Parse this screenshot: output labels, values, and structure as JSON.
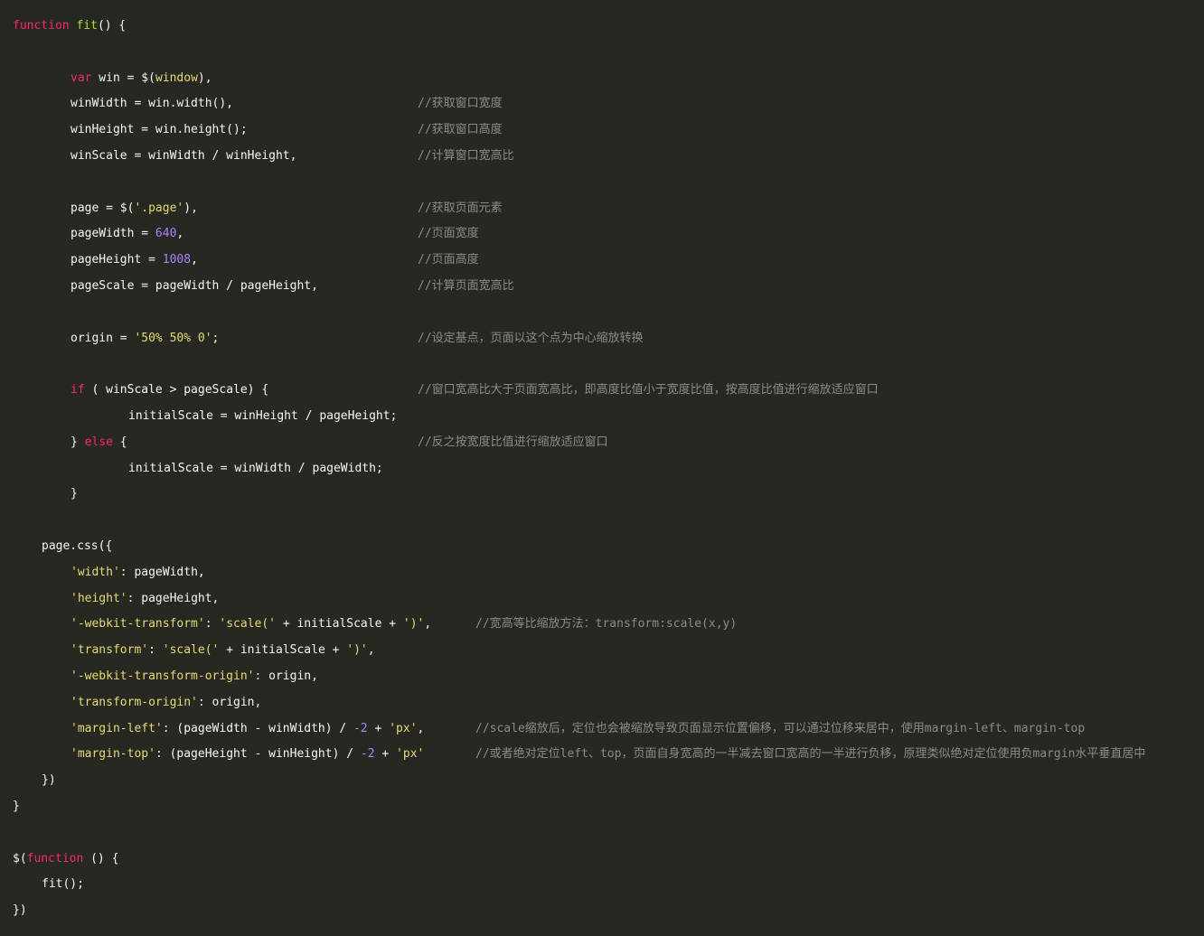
{
  "code": {
    "lines": [
      {
        "indent": 0,
        "tokens": [
          {
            "t": "kw",
            "v": "function"
          },
          {
            "t": "plain",
            "v": " "
          },
          {
            "t": "fn",
            "v": "fit"
          },
          {
            "t": "plain",
            "v": "() {"
          }
        ]
      },
      {
        "indent": 0,
        "tokens": []
      },
      {
        "indent": 8,
        "tokens": [
          {
            "t": "kw",
            "v": "var"
          },
          {
            "t": "plain",
            "v": " win = $("
          },
          {
            "t": "str",
            "v": "window"
          },
          {
            "t": "plain",
            "v": "),"
          }
        ]
      },
      {
        "indent": 8,
        "tokens": [
          {
            "t": "plain",
            "v": "winWidth = win.width(),"
          }
        ],
        "comment": "//获取窗口宽度",
        "ccol": 56
      },
      {
        "indent": 8,
        "tokens": [
          {
            "t": "plain",
            "v": "winHeight = win.height();"
          }
        ],
        "comment": "//获取窗口高度",
        "ccol": 56
      },
      {
        "indent": 8,
        "tokens": [
          {
            "t": "plain",
            "v": "winScale = winWidth / winHeight,"
          }
        ],
        "comment": "//计算窗口宽高比",
        "ccol": 56
      },
      {
        "indent": 0,
        "tokens": []
      },
      {
        "indent": 8,
        "tokens": [
          {
            "t": "plain",
            "v": "page = $("
          },
          {
            "t": "str",
            "v": "'.page'"
          },
          {
            "t": "plain",
            "v": "),"
          }
        ],
        "comment": "//获取页面元素",
        "ccol": 56
      },
      {
        "indent": 8,
        "tokens": [
          {
            "t": "plain",
            "v": "pageWidth = "
          },
          {
            "t": "num",
            "v": "640"
          },
          {
            "t": "plain",
            "v": ","
          }
        ],
        "comment": "//页面宽度",
        "ccol": 56
      },
      {
        "indent": 8,
        "tokens": [
          {
            "t": "plain",
            "v": "pageHeight = "
          },
          {
            "t": "num",
            "v": "1008"
          },
          {
            "t": "plain",
            "v": ","
          }
        ],
        "comment": "//页面高度",
        "ccol": 56
      },
      {
        "indent": 8,
        "tokens": [
          {
            "t": "plain",
            "v": "pageScale = pageWidth / pageHeight,"
          }
        ],
        "comment": "//计算页面宽高比",
        "ccol": 56
      },
      {
        "indent": 0,
        "tokens": []
      },
      {
        "indent": 8,
        "tokens": [
          {
            "t": "plain",
            "v": "origin = "
          },
          {
            "t": "str",
            "v": "'50% 50% 0'"
          },
          {
            "t": "plain",
            "v": ";"
          }
        ],
        "comment": "//设定基点，页面以这个点为中心缩放转换",
        "ccol": 56
      },
      {
        "indent": 0,
        "tokens": []
      },
      {
        "indent": 8,
        "tokens": [
          {
            "t": "kw",
            "v": "if"
          },
          {
            "t": "plain",
            "v": " ( winScale > pageScale) {"
          }
        ],
        "comment": "//窗口宽高比大于页面宽高比，即高度比值小于宽度比值，按高度比值进行缩放适应窗口",
        "ccol": 56
      },
      {
        "indent": 16,
        "tokens": [
          {
            "t": "plain",
            "v": "initialScale = winHeight / pageHeight;"
          }
        ]
      },
      {
        "indent": 8,
        "tokens": [
          {
            "t": "plain",
            "v": "} "
          },
          {
            "t": "kw",
            "v": "else"
          },
          {
            "t": "plain",
            "v": " {"
          }
        ],
        "comment": "//反之按宽度比值进行缩放适应窗口",
        "ccol": 56
      },
      {
        "indent": 16,
        "tokens": [
          {
            "t": "plain",
            "v": "initialScale = winWidth / pageWidth;"
          }
        ]
      },
      {
        "indent": 8,
        "tokens": [
          {
            "t": "plain",
            "v": "}"
          }
        ]
      },
      {
        "indent": 0,
        "tokens": []
      },
      {
        "indent": 4,
        "tokens": [
          {
            "t": "plain",
            "v": "page.css({"
          }
        ]
      },
      {
        "indent": 8,
        "tokens": [
          {
            "t": "str",
            "v": "'width'"
          },
          {
            "t": "plain",
            "v": ": pageWidth,"
          }
        ]
      },
      {
        "indent": 8,
        "tokens": [
          {
            "t": "str",
            "v": "'height'"
          },
          {
            "t": "plain",
            "v": ": pageHeight,"
          }
        ]
      },
      {
        "indent": 8,
        "tokens": [
          {
            "t": "str",
            "v": "'-webkit-transform'"
          },
          {
            "t": "plain",
            "v": ": "
          },
          {
            "t": "str",
            "v": "'scale('"
          },
          {
            "t": "plain",
            "v": " + initialScale + "
          },
          {
            "t": "str",
            "v": "')'"
          },
          {
            "t": "plain",
            "v": ","
          }
        ],
        "comment": "//宽高等比缩放方法：transform:scale(x,y)",
        "ccol": 64
      },
      {
        "indent": 8,
        "tokens": [
          {
            "t": "str",
            "v": "'transform'"
          },
          {
            "t": "plain",
            "v": ": "
          },
          {
            "t": "str",
            "v": "'scale('"
          },
          {
            "t": "plain",
            "v": " + initialScale + "
          },
          {
            "t": "str",
            "v": "')'"
          },
          {
            "t": "plain",
            "v": ","
          }
        ]
      },
      {
        "indent": 8,
        "tokens": [
          {
            "t": "str",
            "v": "'-webkit-transform-origin'"
          },
          {
            "t": "plain",
            "v": ": origin,"
          }
        ]
      },
      {
        "indent": 8,
        "tokens": [
          {
            "t": "str",
            "v": "'transform-origin'"
          },
          {
            "t": "plain",
            "v": ": origin,"
          }
        ]
      },
      {
        "indent": 8,
        "tokens": [
          {
            "t": "str",
            "v": "'margin-left'"
          },
          {
            "t": "plain",
            "v": ": (pageWidth - winWidth) / "
          },
          {
            "t": "num",
            "v": "-2"
          },
          {
            "t": "plain",
            "v": " + "
          },
          {
            "t": "str",
            "v": "'px'"
          },
          {
            "t": "plain",
            "v": ","
          }
        ],
        "comment": "//scale缩放后，定位也会被缩放导致页面显示位置偏移，可以通过位移来居中，使用margin-left、margin-top",
        "ccol": 64
      },
      {
        "indent": 8,
        "tokens": [
          {
            "t": "str",
            "v": "'margin-top'"
          },
          {
            "t": "plain",
            "v": ": (pageHeight - winHeight) / "
          },
          {
            "t": "num",
            "v": "-2"
          },
          {
            "t": "plain",
            "v": " + "
          },
          {
            "t": "str",
            "v": "'px'"
          }
        ],
        "comment": "//或者绝对定位left、top，页面自身宽高的一半减去窗口宽高的一半进行负移，原理类似绝对定位使用负margin水平垂直居中",
        "ccol": 64
      },
      {
        "indent": 4,
        "tokens": [
          {
            "t": "plain",
            "v": "})"
          }
        ]
      },
      {
        "indent": 0,
        "tokens": [
          {
            "t": "plain",
            "v": "}"
          }
        ]
      },
      {
        "indent": 0,
        "tokens": []
      },
      {
        "indent": 0,
        "tokens": [
          {
            "t": "plain",
            "v": "$("
          },
          {
            "t": "kw",
            "v": "function"
          },
          {
            "t": "plain",
            "v": " () {"
          }
        ]
      },
      {
        "indent": 4,
        "tokens": [
          {
            "t": "plain",
            "v": "fit();"
          }
        ]
      },
      {
        "indent": 0,
        "tokens": [
          {
            "t": "plain",
            "v": "})"
          }
        ]
      }
    ]
  },
  "theme": {
    "background": "#272822",
    "keyword": "#F92672",
    "function": "#A6E22E",
    "string": "#E6DB74",
    "number": "#AE81FF",
    "text": "#F8F8F2",
    "comment": "#8C8C84"
  }
}
